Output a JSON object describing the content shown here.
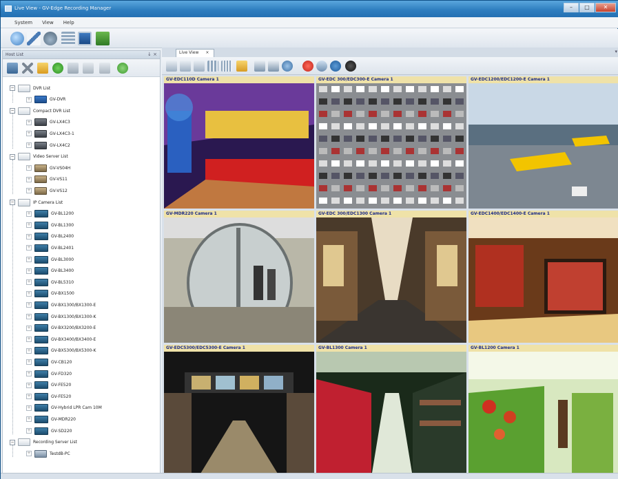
{
  "window": {
    "title": "Live View - GV-Edge Recording Manager",
    "controls": [
      "minimize",
      "maximize",
      "close"
    ]
  },
  "menu": [
    "System",
    "View",
    "Help"
  ],
  "main_toolbar": {
    "icons": [
      "camera-list-icon",
      "edit-icon",
      "playback-icon",
      "grid-view-icon",
      "monitor-icon",
      "network-icon"
    ]
  },
  "host_list": {
    "title": "Host List",
    "header_buttons": "↓  ×",
    "toolbar_icons": [
      "add-host-icon",
      "delete-icon",
      "folder-icon",
      "connect-icon",
      "settings-icon",
      "export-icon",
      "import-icon",
      "refresh-icon"
    ],
    "groups": [
      {
        "label": "DVR List",
        "icon": "list",
        "children": [
          {
            "label": "GV-DVR",
            "icon": "dvr"
          }
        ]
      },
      {
        "label": "Compact DVR List",
        "icon": "list",
        "children": [
          {
            "label": "GV-LX4C3",
            "icon": "compact"
          },
          {
            "label": "GV-LX4C3-1",
            "icon": "compact"
          },
          {
            "label": "GV-LX4C2",
            "icon": "compact"
          }
        ]
      },
      {
        "label": "Video Server List",
        "icon": "list",
        "children": [
          {
            "label": "GV-VS04H",
            "icon": "vs"
          },
          {
            "label": "GV-VS11",
            "icon": "vs"
          },
          {
            "label": "GV-VS12",
            "icon": "vs"
          }
        ]
      },
      {
        "label": "IP Camera List",
        "icon": "list",
        "children": [
          {
            "label": "GV-BL1200",
            "icon": "cam"
          },
          {
            "label": "GV-BL1300",
            "icon": "cam"
          },
          {
            "label": "GV-BL2400",
            "icon": "cam"
          },
          {
            "label": "GV-BL2401",
            "icon": "cam"
          },
          {
            "label": "GV-BL3000",
            "icon": "cam"
          },
          {
            "label": "GV-BL3400",
            "icon": "cam"
          },
          {
            "label": "GV-BL5310",
            "icon": "cam"
          },
          {
            "label": "GV-BX1500",
            "icon": "cam"
          },
          {
            "label": "GV-BX1300/BX1300-E",
            "icon": "cam"
          },
          {
            "label": "GV-BX1300/BX1300-K",
            "icon": "cam"
          },
          {
            "label": "GV-BX3200/BX3200-E",
            "icon": "cam"
          },
          {
            "label": "GV-BX3400/BX3400-E",
            "icon": "cam"
          },
          {
            "label": "GV-BX5300/BX5300-K",
            "icon": "cam"
          },
          {
            "label": "GV-CB120",
            "icon": "cam"
          },
          {
            "label": "GV-FD320",
            "icon": "cam"
          },
          {
            "label": "GV-FE520",
            "icon": "cam"
          },
          {
            "label": "GV-FE520",
            "icon": "cam"
          },
          {
            "label": "GV-Hybrid LPR Cam 10M",
            "icon": "cam"
          },
          {
            "label": "GV-MDR220",
            "icon": "cam"
          },
          {
            "label": "GV-SD220",
            "icon": "cam"
          }
        ]
      },
      {
        "label": "Recording Server List",
        "icon": "list",
        "children": [
          {
            "label": "TestdB-PC",
            "icon": "pc"
          }
        ]
      }
    ]
  },
  "live_view": {
    "tab_label": "Live View",
    "tab_close": "×",
    "tab_menu": "▾",
    "toolbar_icons": [
      "zoom-in-icon",
      "zoom-out-icon",
      "layout-1-icon",
      "layout-4-icon",
      "layout-9-icon",
      "snapshot-icon",
      "layout-split-icon",
      "fullscreen-icon",
      "rotate-icon",
      "stop-icon",
      "monitor-icon",
      "record-icon",
      "camera-icon"
    ],
    "cameras": [
      {
        "label": "GV-EDC110D Camera 1",
        "scene": "cinema"
      },
      {
        "label": "GV-EDC 300/EDC300-E Camera 1",
        "scene": "parking"
      },
      {
        "label": "GV-EDC1200/EDC1200-E Camera 1",
        "scene": "airport"
      },
      {
        "label": "GV-MDR220 Camera 1",
        "scene": "revolving-door"
      },
      {
        "label": "GV-EDC 300/EDC1300 Camera 1",
        "scene": "arcade"
      },
      {
        "label": "GV-EDC1400/EDC1400-E Camera 1",
        "scene": "store"
      },
      {
        "label": "GV-EDC5300/EDC5300-E Camera 1",
        "scene": "escalator"
      },
      {
        "label": "GV-BL1300 Camera 1",
        "scene": "warehouse"
      },
      {
        "label": "GV-BL1200 Camera 1",
        "scene": "supermarket"
      }
    ]
  },
  "colors": {
    "label_bg": "#efe2a8",
    "label_text": "#1b2a86",
    "titlebar": "#2f7fc0"
  }
}
